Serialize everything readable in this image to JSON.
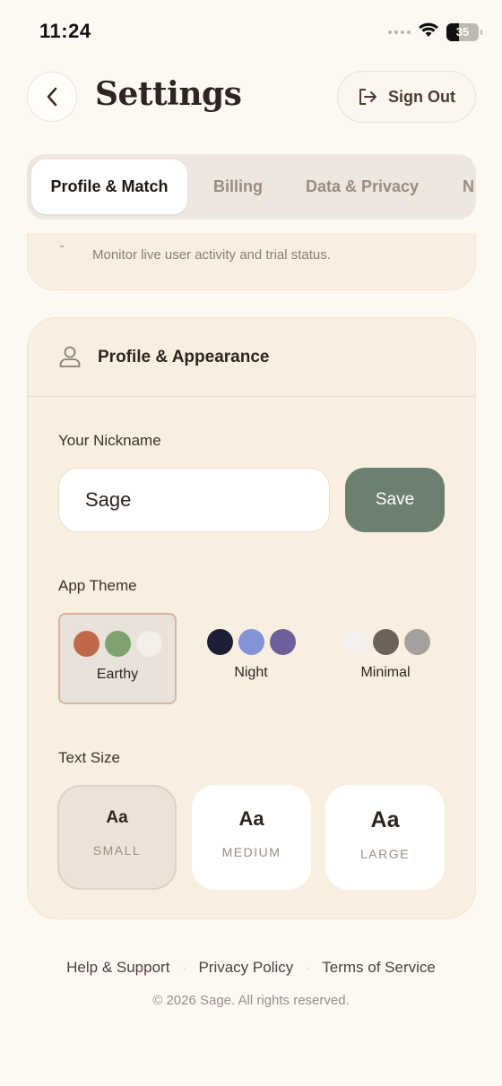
{
  "status_bar": {
    "time": "11:24",
    "battery": "35"
  },
  "header": {
    "title": "Settings",
    "sign_out_label": "Sign Out"
  },
  "tabs": [
    {
      "label": "Profile & Match",
      "active": true
    },
    {
      "label": "Billing",
      "active": false
    },
    {
      "label": "Data & Privacy",
      "active": false
    },
    {
      "label": "N",
      "active": false
    }
  ],
  "previous_card": {
    "description": "Monitor live user activity and trial status."
  },
  "profile_card": {
    "title": "Profile & Appearance",
    "nickname_label": "Your Nickname",
    "nickname_value": "Sage",
    "save_label": "Save",
    "theme_label": "App Theme",
    "themes": [
      {
        "name": "Earthy",
        "selected": true,
        "colors": [
          "#c0694a",
          "#80a070",
          "#f2efe9"
        ]
      },
      {
        "name": "Night",
        "selected": false,
        "colors": [
          "#1b1e36",
          "#8393d6",
          "#6e5f9a"
        ]
      },
      {
        "name": "Minimal",
        "selected": false,
        "colors": [
          "#f4f1ec",
          "#6d625a",
          "#a4a09b"
        ]
      }
    ],
    "text_size_label": "Text Size",
    "text_sizes": [
      {
        "sample": "Aa",
        "name": "SMALL",
        "selected": true
      },
      {
        "sample": "Aa",
        "name": "MEDIUM",
        "selected": false
      },
      {
        "sample": "Aa",
        "name": "LARGE",
        "selected": false
      }
    ]
  },
  "footer": {
    "links": [
      "Help & Support",
      "Privacy Policy",
      "Terms of Service"
    ],
    "separator": "·",
    "copyright": "© 2026 Sage. All rights reserved."
  },
  "colors": {
    "background": "#fcf8f2",
    "card": "#f8efe1",
    "accent": "#6d7f6e",
    "selected_border": "#d9b3a2"
  }
}
